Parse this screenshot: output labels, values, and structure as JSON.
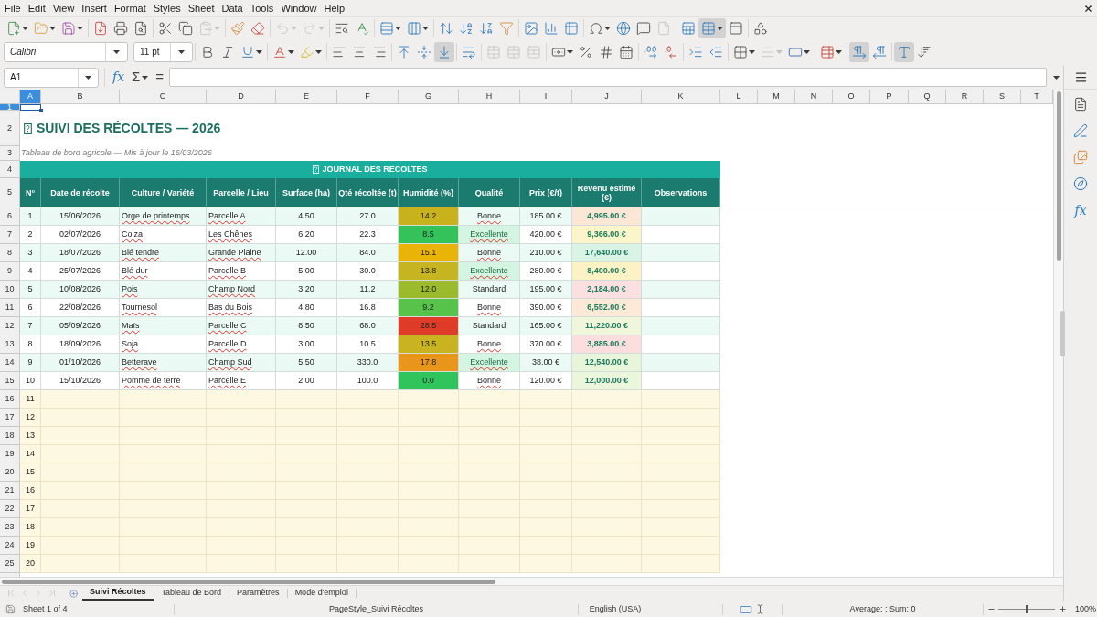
{
  "menu": [
    "File",
    "Edit",
    "View",
    "Insert",
    "Format",
    "Styles",
    "Sheet",
    "Data",
    "Tools",
    "Window",
    "Help"
  ],
  "standard_toolbar": {
    "paste": {
      "disabled": true
    },
    "undo": {
      "disabled": true
    },
    "redo": {
      "disabled": true
    },
    "header_footer": {
      "disabled": true
    },
    "freeze_panes": {
      "on": true
    }
  },
  "formatting_toolbar": {
    "font_name": "Calibri",
    "font_size": "11 pt",
    "align_bottom": {
      "on": true
    },
    "merge_center": {
      "disabled": true
    },
    "merge_cells": {
      "disabled": true
    },
    "unmerge_cells": {
      "disabled": true
    },
    "border_style": {
      "disabled": true
    },
    "paragraph_ltr": {
      "on": true
    },
    "text_direction_ltr": {
      "on": true
    }
  },
  "formula_bar": {
    "name_box": "A1",
    "buttons": [
      "fx",
      "Σ",
      "="
    ]
  },
  "sheet": {
    "columns": [
      {
        "label": "A",
        "selected": true
      },
      {
        "label": "B",
        "selected": false
      },
      {
        "label": "C",
        "selected": false
      },
      {
        "label": "D",
        "selected": false
      },
      {
        "label": "E",
        "selected": false
      },
      {
        "label": "F",
        "selected": false
      },
      {
        "label": "G",
        "selected": false
      },
      {
        "label": "H",
        "selected": false
      },
      {
        "label": "I",
        "selected": false
      },
      {
        "label": "J",
        "selected": false
      },
      {
        "label": "K",
        "selected": false
      },
      {
        "label": "L",
        "selected": false
      },
      {
        "label": "M",
        "selected": false
      },
      {
        "label": "N",
        "selected": false
      },
      {
        "label": "O",
        "selected": false
      },
      {
        "label": "P",
        "selected": false
      },
      {
        "label": "Q",
        "selected": false
      },
      {
        "label": "R",
        "selected": false
      },
      {
        "label": "S",
        "selected": false
      },
      {
        "label": "T",
        "selected": false
      }
    ],
    "rows": [
      {
        "label": "1",
        "selected": true
      },
      {
        "label": "2",
        "selected": false
      },
      {
        "label": "3",
        "selected": false
      },
      {
        "label": "4",
        "selected": false
      },
      {
        "label": "5",
        "selected": false
      },
      {
        "label": "6",
        "selected": false
      },
      {
        "label": "7",
        "selected": false
      },
      {
        "label": "8",
        "selected": false
      },
      {
        "label": "9",
        "selected": false
      },
      {
        "label": "10",
        "selected": false
      },
      {
        "label": "11",
        "selected": false
      },
      {
        "label": "12",
        "selected": false
      },
      {
        "label": "13",
        "selected": false
      },
      {
        "label": "14",
        "selected": false
      },
      {
        "label": "15",
        "selected": false
      },
      {
        "label": "16",
        "selected": false
      },
      {
        "label": "17",
        "selected": false
      },
      {
        "label": "18",
        "selected": false
      },
      {
        "label": "19",
        "selected": false
      },
      {
        "label": "20",
        "selected": false
      },
      {
        "label": "21",
        "selected": false
      },
      {
        "label": "22",
        "selected": false
      },
      {
        "label": "23",
        "selected": false
      },
      {
        "label": "24",
        "selected": false
      },
      {
        "label": "25",
        "selected": false
      }
    ],
    "title": "SUIVI DES RÉCOLTES — 2026",
    "subtitle": "Tableau de bord agricole — Mis à jour le 16/03/2026",
    "banner": "JOURNAL DES RÉCOLTES",
    "table": {
      "columns": [
        "N°",
        "Date de récolte",
        "Culture / Variété",
        "Parcelle / Lieu",
        "Surface (ha)",
        "Qté récoltée (t)",
        "Humidité (%)",
        "Qualité",
        "Prix (€/t)",
        "Revenu estimé (€)",
        "Observations"
      ],
      "rows": [
        {
          "shaded": true,
          "number": "1",
          "date": "15/06/2026",
          "culture": {
            "value": "Orge de printemps",
            "misspelled": true
          },
          "parcel": {
            "value": "Parcelle A",
            "misspelled": true
          },
          "surface": "4.50",
          "quantity": "27.0",
          "humidity": {
            "value": "14.2",
            "color": "#c8b21e"
          },
          "quality": {
            "value": "Bonne",
            "misspelled": true
          },
          "price": "185.00 €",
          "revenue": {
            "value": "4,995.00 €",
            "color": "#fce6d6"
          }
        },
        {
          "shaded": false,
          "number": "2",
          "date": "02/07/2026",
          "culture": {
            "value": "Colza",
            "misspelled": true
          },
          "parcel": {
            "value": "Les Chênes",
            "misspelled": true
          },
          "surface": "6.20",
          "quantity": "22.3",
          "humidity": {
            "value": "8.5",
            "color": "#33c35a"
          },
          "quality": {
            "value": "Excellente",
            "misspelled": true,
            "color": "#d3f5e1"
          },
          "price": "420.00 €",
          "revenue": {
            "value": "9,366.00 €",
            "color": "#fbf5c9"
          }
        },
        {
          "shaded": true,
          "number": "3",
          "date": "18/07/2026",
          "culture": {
            "value": "Blé tendre",
            "misspelled": true
          },
          "parcel": {
            "value": "Grande Plaine",
            "misspelled": true
          },
          "surface": "12.00",
          "quantity": "84.0",
          "humidity": {
            "value": "15.1",
            "color": "#e9b307"
          },
          "quality": {
            "value": "Bonne",
            "misspelled": true
          },
          "price": "210.00 €",
          "revenue": {
            "value": "17,640.00 €",
            "color": "#d9f3e5"
          }
        },
        {
          "shaded": false,
          "number": "4",
          "date": "25/07/2026",
          "culture": {
            "value": "Blé dur",
            "misspelled": true
          },
          "parcel": {
            "value": "Parcelle B",
            "misspelled": true
          },
          "surface": "5.00",
          "quantity": "30.0",
          "humidity": {
            "value": "13.8",
            "color": "#c6b520"
          },
          "quality": {
            "value": "Excellente",
            "misspelled": true,
            "color": "#d3f5e1"
          },
          "price": "280.00 €",
          "revenue": {
            "value": "8,400.00 €",
            "color": "#fcf2c3"
          }
        },
        {
          "shaded": true,
          "number": "5",
          "date": "10/08/2026",
          "culture": {
            "value": "Pois",
            "misspelled": true
          },
          "parcel": {
            "value": "Champ Nord",
            "misspelled": true
          },
          "surface": "3.20",
          "quantity": "11.2",
          "humidity": {
            "value": "12.0",
            "color": "#9cbb2c"
          },
          "quality": {
            "value": "Standard",
            "misspelled": false
          },
          "price": "195.00 €",
          "revenue": {
            "value": "2,184.00 €",
            "color": "#fcdfe0"
          }
        },
        {
          "shaded": false,
          "number": "6",
          "date": "22/08/2026",
          "culture": {
            "value": "Tournesol",
            "misspelled": true
          },
          "parcel": {
            "value": "Bas du Bois",
            "misspelled": true
          },
          "surface": "4.80",
          "quantity": "16.8",
          "humidity": {
            "value": "9.2",
            "color": "#57c34a"
          },
          "quality": {
            "value": "Bonne",
            "misspelled": true
          },
          "price": "390.00 €",
          "revenue": {
            "value": "6,552.00 €",
            "color": "#fce9d6"
          }
        },
        {
          "shaded": true,
          "number": "7",
          "date": "05/09/2026",
          "culture": {
            "value": "Maïs",
            "misspelled": true
          },
          "parcel": {
            "value": "Parcelle C",
            "misspelled": true
          },
          "surface": "8.50",
          "quantity": "68.0",
          "humidity": {
            "value": "28.5",
            "color": "#e03a28"
          },
          "quality": {
            "value": "Standard",
            "misspelled": false
          },
          "price": "165.00 €",
          "revenue": {
            "value": "11,220.00 €",
            "color": "#eff6d9"
          }
        },
        {
          "shaded": false,
          "number": "8",
          "date": "18/09/2026",
          "culture": {
            "value": "Soja",
            "misspelled": true
          },
          "parcel": {
            "value": "Parcelle D",
            "misspelled": true
          },
          "surface": "3.00",
          "quantity": "10.5",
          "humidity": {
            "value": "13.5",
            "color": "#c9b41f"
          },
          "quality": {
            "value": "Bonne",
            "misspelled": true
          },
          "price": "370.00 €",
          "revenue": {
            "value": "3,885.00 €",
            "color": "#fcdede"
          }
        },
        {
          "shaded": true,
          "number": "9",
          "date": "01/10/2026",
          "culture": {
            "value": "Betterave",
            "misspelled": true
          },
          "parcel": {
            "value": "Champ Sud",
            "misspelled": true
          },
          "surface": "5.50",
          "quantity": "330.0",
          "humidity": {
            "value": "17.8",
            "color": "#ea951c"
          },
          "quality": {
            "value": "Excellente",
            "misspelled": true,
            "color": "#d3f5e1"
          },
          "price": "38.00 €",
          "revenue": {
            "value": "12,540.00 €",
            "color": "#e9f5da"
          }
        },
        {
          "shaded": false,
          "number": "10",
          "date": "15/10/2026",
          "culture": {
            "value": "Pomme de terre",
            "misspelled": true
          },
          "parcel": {
            "value": "Parcelle E",
            "misspelled": true
          },
          "surface": "2.00",
          "quantity": "100.0",
          "humidity": {
            "value": "0.0",
            "color": "#2fc55c"
          },
          "quality": {
            "value": "Bonne",
            "misspelled": true
          },
          "price": "120.00 €",
          "revenue": {
            "value": "12,000.00 €",
            "color": "#ebf6da"
          }
        }
      ]
    },
    "empty_rows": [
      "11",
      "12",
      "13",
      "14",
      "15",
      "16",
      "17",
      "18",
      "19",
      "20"
    ]
  },
  "sheet_tabs": {
    "navigation": {
      "disabled": true
    },
    "tabs": [
      {
        "label": "Suivi Récoltes",
        "selected": true
      },
      {
        "label": "Tableau de Bord",
        "selected": false
      },
      {
        "label": "Paramètres",
        "selected": false
      },
      {
        "label": "Mode d'emploi",
        "selected": false
      }
    ]
  },
  "sidebar": {
    "functions_button": "fx"
  },
  "status_bar": {
    "sheet_position": "Sheet 1 of 4",
    "page_style": "PageStyle_Suivi Récoltes",
    "language": "English (USA)",
    "selection_summary": "Average: ; Sum: 0",
    "zoom": {
      "level": 0.5,
      "reading": "100%"
    }
  }
}
